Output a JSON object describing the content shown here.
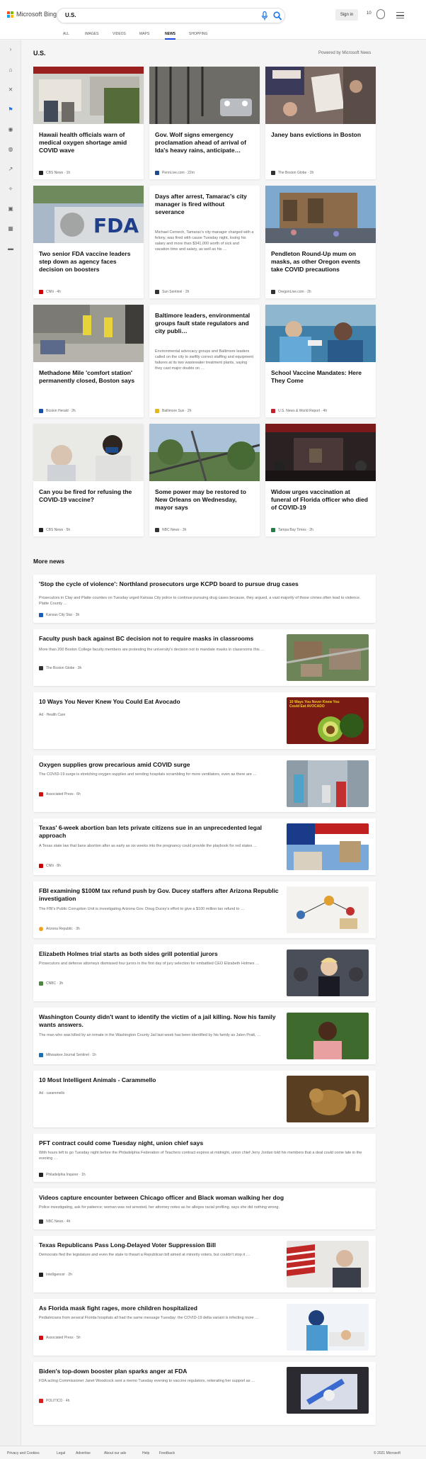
{
  "brand": {
    "name": "Microsoft Bing",
    "colors": [
      "#f25022",
      "#7fba00",
      "#00a4ef",
      "#ffb900"
    ]
  },
  "search": {
    "query": "U.S.",
    "mic_icon": "mic-icon",
    "search_icon": "search-icon"
  },
  "account": {
    "signin": "Sign in",
    "rewards_count": "10"
  },
  "tabs": [
    "ALL",
    "IMAGES",
    "VIDEOS",
    "MAPS",
    "NEWS",
    "SHOPPING"
  ],
  "active_tab": "NEWS",
  "sidebar_icons": [
    "expand-icon",
    "home-icon",
    "sports-icon",
    "flag-icon",
    "location-icon",
    "world-icon",
    "trending-icon",
    "science-icon",
    "video-icon",
    "money-icon",
    "wallet-icon"
  ],
  "section": {
    "title": "U.S.",
    "powered": "Powered by Microsoft News"
  },
  "cards": [
    {
      "title": "Hawaii health officials warn of medical oxygen shortage amid COVID wave",
      "source": "CBS News",
      "time": "1h"
    },
    {
      "title": "Gov. Wolf signs emergency proclamation ahead of arrival of Ida's heavy rains, anticipate…",
      "source": "PennLive.com",
      "time": "22m"
    },
    {
      "title": "Janey bans evictions in Boston",
      "source": "The Boston Globe",
      "time": "2h"
    },
    {
      "title": "Two senior FDA vaccine leaders step down as agency faces decision on boosters",
      "source": "CNN",
      "time": "4h"
    },
    {
      "title": "Days after arrest, Tamarac's city manager is fired without severance",
      "snippet": "Michael Cernech, Tamarac's city manager charged with a felony, was fired with cause Tuesday night, losing his salary and more than $341,000 worth of sick and vacation time and salary, as well as his …",
      "source": "Sun Sentinel",
      "time": "2h"
    },
    {
      "title": "Pendleton Round-Up mum on masks, as other Oregon events take COVID precautions",
      "source": "OregonLive.com",
      "time": "2h"
    },
    {
      "title": "Methadone Mile 'comfort station' permanently closed, Boston says",
      "source": "Boston Herald",
      "time": "2h"
    },
    {
      "title": "Baltimore leaders, environmental groups fault state regulators and city publi…",
      "snippet": "Environmental advocacy groups and Baltimore leaders called on the city to swiftly correct staffing and equipment failures at its two wastewater treatment plants, saying they cast major doubts on …",
      "source": "Baltimore Sun",
      "time": "2h"
    },
    {
      "title": "School Vaccine Mandates: Here They Come",
      "source": "U.S. News & World Report",
      "time": "4h"
    },
    {
      "title": "Can you be fired for refusing the COVID-19 vaccine?",
      "source": "CBS News",
      "time": "5h"
    },
    {
      "title": "Some power may be restored to New Orleans on Wednesday, mayor says",
      "source": "NBC News",
      "time": "3h"
    },
    {
      "title": "Widow urges vaccination at funeral of Florida officer who died of COVID-19",
      "source": "Tampa Bay Times",
      "time": "2h"
    }
  ],
  "more_news": {
    "title": "More news",
    "items": [
      {
        "title": "'Stop the cycle of violence': Northland prosecutors urge KCPD board to pursue drug cases",
        "snippet": "Prosecutors in Clay and Platte counties on Tuesday urged Kansas City police to continue pursuing drug cases because, they argued, a vast majority of those crimes often lead to violence. Platte County …",
        "source": "Kansas City Star",
        "time": "3h"
      },
      {
        "title": "Faculty push back against BC decision not to require masks in classrooms",
        "snippet": "More than 200 Boston College faculty members are protesting the university's decision not to mandate masks in classrooms this …",
        "source": "The Boston Globe",
        "time": "3h"
      },
      {
        "title": "10 Ways You Never Knew You Could Eat Avocado",
        "ad": "Ad",
        "source": "Health Care",
        "img_text": "10 Ways You Never Knew You Could Eat AVOCADO"
      },
      {
        "title": "Oxygen supplies grow precarious amid COVID surge",
        "snippet": "The COVID-19 surge is stretching oxygen supplies and sending hospitals scrambling for more ventilators, even as there are …",
        "source": "Associated Press",
        "time": "6h"
      },
      {
        "title": "Texas' 6-week abortion ban lets private citizens sue in an unprecedented legal approach",
        "snippet": "A Texas state law that bans abortion after as early as six weeks into the pregnancy could provide the playbook for red states …",
        "source": "CNN",
        "time": "8h"
      },
      {
        "title": "FBI examining $100M tax refund push by Gov. Ducey staffers after Arizona Republic investigation",
        "snippet": "The FBI's Public Corruption Unit is investigating Arizona Gov. Doug Ducey's effort to give a $100 million tax refund to …",
        "source": "Arizona Republic",
        "time": "3h"
      },
      {
        "title": "Elizabeth Holmes trial starts as both sides grill potential jurors",
        "snippet": "Prosecutors and defense attorneys dismissed four jurors in the first day of jury selection for embattled CEO Elizabeth Holmes …",
        "source": "CNBC",
        "time": "3h"
      },
      {
        "title": "Washington County didn't want to identify the victim of a jail killing. Now his family wants answers.",
        "snippet": "The man who was killed by an inmate in the Washington County Jail last week has been identified by his family as Jalen Pratt, …",
        "source": "Milwaukee Journal Sentinel",
        "time": "1h"
      },
      {
        "title": "10 Most Intelligent Animals - Carammello",
        "ad": "Ad",
        "source": "carammello"
      },
      {
        "title": "PFT contract could come Tuesday night, union chief says",
        "snippet": "With hours left to go Tuesday night before the Philadelphia Federation of Teachers contract expires at midnight, union chief Jerry Jordan told his members that a deal could come late in the evening …",
        "source": "Philadelphia Inquirer",
        "time": "1h"
      },
      {
        "title": "Videos capture encounter between Chicago officer and Black woman walking her dog",
        "snippet": "Police investigating, ask for patience; woman was not arrested, her attorney notes as he alleges racial profiling, says she did nothing wrong.",
        "source": "NBC News",
        "time": "4h"
      },
      {
        "title": "Texas Republicans Pass Long-Delayed Voter Suppression Bill",
        "snippet": "Democrats fled the legislature and even the state to thwart a Republican bill aimed at minority voters, but couldn't stop it …",
        "source": "Intelligencer",
        "time": "2h"
      },
      {
        "title": "As Florida mask fight rages, more children hospitalized",
        "snippet": "Pediatricians from several Florida hospitals all had the same message Tuesday: the COVID-19 delta variant is infecting more …",
        "source": "Associated Press",
        "time": "5h"
      },
      {
        "title": "Biden's top-down booster plan sparks anger at FDA",
        "snippet": "FDA acting Commissioner Janet Woodcock sent a memo Tuesday evening to vaccine regulators, reiterating her support as …",
        "source": "POLITICO",
        "time": "4h"
      }
    ]
  },
  "footer": {
    "links": [
      "Privacy and Cookies",
      "Legal",
      "Advertise",
      "About our ads",
      "Help",
      "Feedback"
    ],
    "copyright": "© 2021 Microsoft"
  }
}
